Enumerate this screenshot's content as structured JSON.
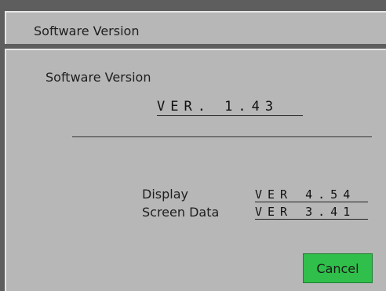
{
  "window": {
    "title": "Software Version"
  },
  "main": {
    "heading": "Software Version",
    "version": "VER. 1.43",
    "rows": [
      {
        "label": "Display",
        "value": "VER 4.54"
      },
      {
        "label": "Screen Data",
        "value": "VER 3.41"
      }
    ]
  },
  "buttons": {
    "cancel_label": "Cancel"
  },
  "colors": {
    "background": "#5e5e5e",
    "panel": "#b7b7b7",
    "cancel_button": "#2fbf4a"
  }
}
